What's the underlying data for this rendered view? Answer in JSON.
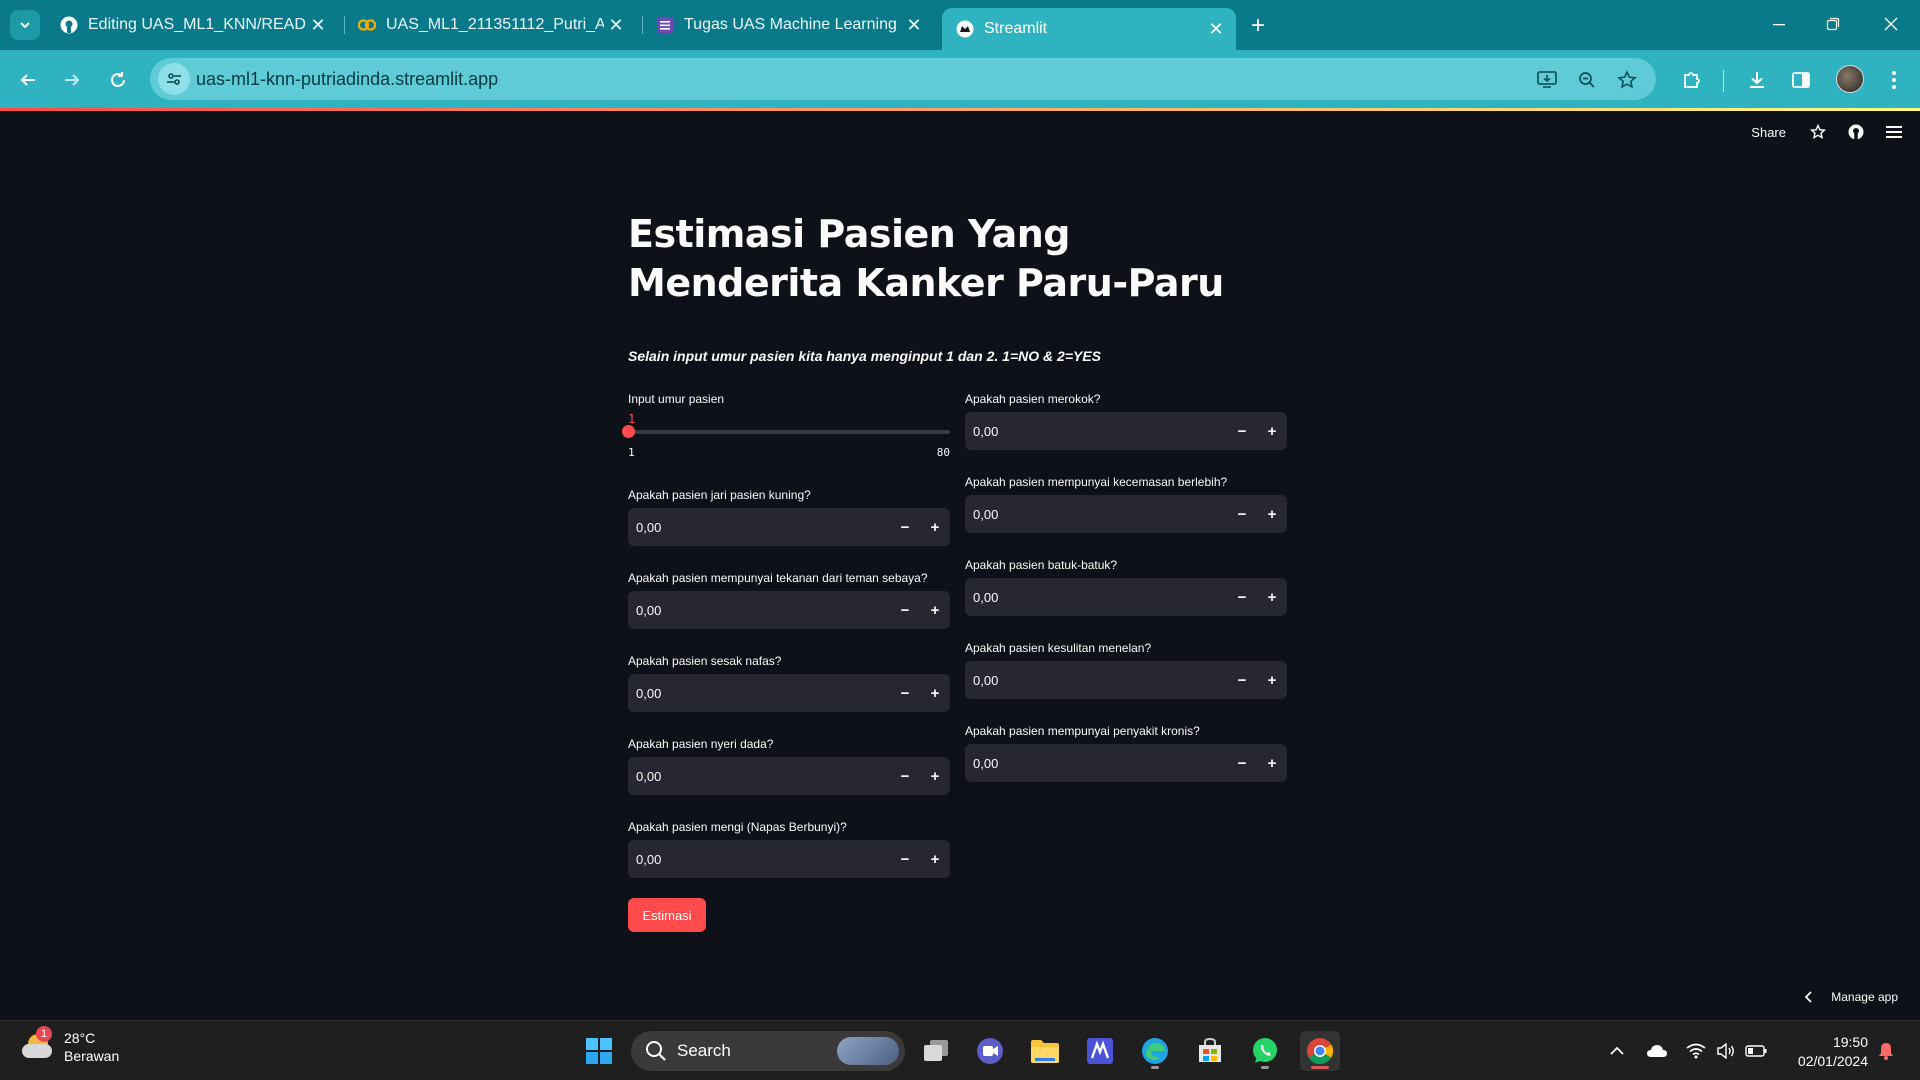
{
  "browser": {
    "tabs": [
      {
        "title": "Editing UAS_ML1_KNN/README.md",
        "icon": "github-icon"
      },
      {
        "title": "UAS_ML1_211351112_Putri_Adinda",
        "icon": "colab-icon"
      },
      {
        "title": "Tugas UAS Machine Learning 1",
        "icon": "forms-icon"
      },
      {
        "title": "Streamlit",
        "icon": "streamlit-icon"
      }
    ],
    "url": "uas-ml1-knn-putriadinda.streamlit.app"
  },
  "header": {
    "share_label": "Share"
  },
  "page": {
    "title": "Estimasi Pasien Yang Menderita Kanker Paru-Paru",
    "subtitle": "Selain input umur pasien kita hanya menginput 1 dan 2. 1=NO & 2=YES",
    "slider": {
      "label": "Input umur pasien",
      "value": "1",
      "min": "1",
      "max": "80"
    },
    "left_fields": [
      {
        "label": "Apakah pasien jari pasien kuning?",
        "value": "0,00"
      },
      {
        "label": "Apakah pasien mempunyai tekanan dari teman sebaya?",
        "value": "0,00"
      },
      {
        "label": "Apakah pasien sesak nafas?",
        "value": "0,00"
      },
      {
        "label": "Apakah pasien nyeri dada?",
        "value": "0,00"
      },
      {
        "label": "Apakah pasien mengi (Napas Berbunyi)?",
        "value": "0,00"
      }
    ],
    "right_fields": [
      {
        "label": "Apakah pasien merokok?",
        "value": "0,00"
      },
      {
        "label": "Apakah pasien mempunyai kecemasan berlebih?",
        "value": "0,00"
      },
      {
        "label": "Apakah pasien batuk-batuk?",
        "value": "0,00"
      },
      {
        "label": "Apakah pasien kesulitan menelan?",
        "value": "0,00"
      },
      {
        "label": "Apakah pasien mempunyai penyakit kronis?",
        "value": "0,00"
      }
    ],
    "button_label": "Estimasi",
    "stepper_minus": "−",
    "stepper_plus": "+"
  },
  "manage_app_label": "Manage app",
  "taskbar": {
    "weather_temp": "28°C",
    "weather_desc": "Berawan",
    "weather_badge": "1",
    "search_label": "Search",
    "time": "19:50",
    "date": "02/01/2024"
  },
  "colors": {
    "accent": "#ff4b4b",
    "background": "#0e1117",
    "input_bg": "#262730",
    "chrome_tab": "#0a7a8a",
    "chrome_toolbar": "#2fb3c0"
  }
}
